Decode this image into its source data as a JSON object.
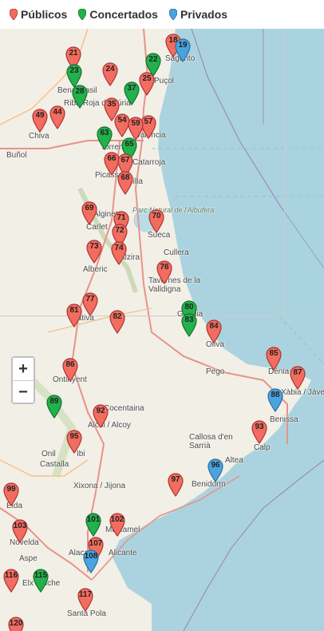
{
  "legend": [
    {
      "label": "Públicos",
      "color": "#f26d5f"
    },
    {
      "label": "Concertados",
      "color": "#22b14c"
    },
    {
      "label": "Privados",
      "color": "#4aa3df"
    }
  ],
  "zoom": {
    "in_label": "+",
    "out_label": "−"
  },
  "places": [
    {
      "label": "Sagunto"
    },
    {
      "label": "Puçol"
    },
    {
      "label": "Benaguasil"
    },
    {
      "label": "Riba-Roja de Túria"
    },
    {
      "label": "Chiva"
    },
    {
      "label": "Buñol"
    },
    {
      "label": "València"
    },
    {
      "label": "Torrent"
    },
    {
      "label": "Picassent"
    },
    {
      "label": "Silla"
    },
    {
      "label": "Catarroja"
    },
    {
      "label": "Parc Natural de l'Albufera"
    },
    {
      "label": "Alginet"
    },
    {
      "label": "Carlet"
    },
    {
      "label": "Sueca"
    },
    {
      "label": "Cullera"
    },
    {
      "label": "Alzira"
    },
    {
      "label": "Alberic"
    },
    {
      "label": "Tavernes de la Valldigna"
    },
    {
      "label": "Xàtiva"
    },
    {
      "label": "Gandia"
    },
    {
      "label": "Oliva"
    },
    {
      "label": "Ontinyent"
    },
    {
      "label": "Pego"
    },
    {
      "label": "Dénia"
    },
    {
      "label": "Xàbia / Jávea"
    },
    {
      "label": "Benissa"
    },
    {
      "label": "Calp"
    },
    {
      "label": "Callosa d'en Sarrià"
    },
    {
      "label": "Altea"
    },
    {
      "label": "Benidorm"
    },
    {
      "label": "Alcoi / Alcoy"
    },
    {
      "label": "Ibi"
    },
    {
      "label": "Onil"
    },
    {
      "label": "Castalla"
    },
    {
      "label": "Xixona / Jijona"
    },
    {
      "label": "Elda"
    },
    {
      "label": "Novelda"
    },
    {
      "label": "Aspe"
    },
    {
      "label": "Elx / Elche"
    },
    {
      "label": "Alacant"
    },
    {
      "label": "Alicante"
    },
    {
      "label": "Santa Pola"
    },
    {
      "label": "Mutxamel"
    },
    {
      "label": "Cocentaina"
    }
  ],
  "markers": [
    {
      "n": "18",
      "type": "publico"
    },
    {
      "n": "19",
      "type": "privado"
    },
    {
      "n": "21",
      "type": "publico"
    },
    {
      "n": "22",
      "type": "concertado"
    },
    {
      "n": "23",
      "type": "concertado"
    },
    {
      "n": "24",
      "type": "publico"
    },
    {
      "n": "25",
      "type": "publico"
    },
    {
      "n": "28",
      "type": "concertado"
    },
    {
      "n": "37",
      "type": "concertado"
    },
    {
      "n": "35",
      "type": "publico"
    },
    {
      "n": "49",
      "type": "publico"
    },
    {
      "n": "44",
      "type": "publico"
    },
    {
      "n": "54",
      "type": "publico"
    },
    {
      "n": "57",
      "type": "publico"
    },
    {
      "n": "59",
      "type": "publico"
    },
    {
      "n": "63",
      "type": "concertado"
    },
    {
      "n": "65",
      "type": "concertado"
    },
    {
      "n": "66",
      "type": "publico"
    },
    {
      "n": "67",
      "type": "publico"
    },
    {
      "n": "68",
      "type": "publico"
    },
    {
      "n": "69",
      "type": "publico"
    },
    {
      "n": "71",
      "type": "publico"
    },
    {
      "n": "70",
      "type": "publico"
    },
    {
      "n": "72",
      "type": "publico"
    },
    {
      "n": "73",
      "type": "publico"
    },
    {
      "n": "74",
      "type": "publico"
    },
    {
      "n": "76",
      "type": "publico"
    },
    {
      "n": "77",
      "type": "publico"
    },
    {
      "n": "81",
      "type": "publico"
    },
    {
      "n": "82",
      "type": "publico"
    },
    {
      "n": "80",
      "type": "concertado"
    },
    {
      "n": "83",
      "type": "concertado"
    },
    {
      "n": "84",
      "type": "publico"
    },
    {
      "n": "85",
      "type": "publico"
    },
    {
      "n": "87",
      "type": "publico"
    },
    {
      "n": "86",
      "type": "publico"
    },
    {
      "n": "88",
      "type": "privado"
    },
    {
      "n": "89",
      "type": "concertado"
    },
    {
      "n": "92",
      "type": "publico"
    },
    {
      "n": "93",
      "type": "publico"
    },
    {
      "n": "95",
      "type": "publico"
    },
    {
      "n": "96",
      "type": "privado"
    },
    {
      "n": "97",
      "type": "publico"
    },
    {
      "n": "99",
      "type": "publico"
    },
    {
      "n": "103",
      "type": "publico"
    },
    {
      "n": "101",
      "type": "concertado"
    },
    {
      "n": "102",
      "type": "publico"
    },
    {
      "n": "107",
      "type": "publico"
    },
    {
      "n": "108",
      "type": "privado"
    },
    {
      "n": "115",
      "type": "concertado"
    },
    {
      "n": "116",
      "type": "publico"
    },
    {
      "n": "117",
      "type": "publico"
    },
    {
      "n": "120",
      "type": "publico"
    }
  ]
}
